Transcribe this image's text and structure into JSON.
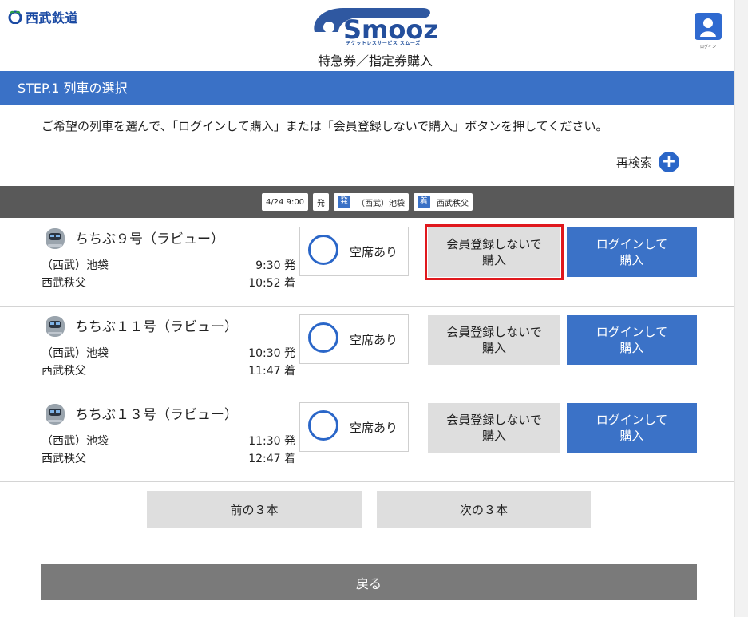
{
  "header": {
    "brand_name": "西武鉄道",
    "logo_text": "Smooz",
    "logo_subtitle": "チケットレスサービス スムーズ",
    "page_title": "特急券／指定券購入",
    "login_caption": "ログイン"
  },
  "step": {
    "title": "STEP.1 列車の選択"
  },
  "instruction": "ご希望の列車を選んで、「ログインして購入」または「会員登録しないで購入」ボタンを押してください。",
  "research_label": "再検索",
  "search_conditions": {
    "datetime": "4/24 9:00",
    "dep_tag": "発",
    "dep_tag2": "発",
    "dep_station": "（西武）池袋",
    "arr_tag": "着",
    "arr_station": "西武秩父"
  },
  "trains": [
    {
      "name": "ちちぶ９号（ラビュー）",
      "dep_station": "（西武）池袋",
      "dep_time": "9:30 発",
      "arr_station": "西武秩父",
      "arr_time": "10:52 着",
      "availability": "空席あり",
      "guest_button": "会員登録しないで 購入",
      "login_button": "ログインして 購入"
    },
    {
      "name": "ちちぶ１１号（ラビュー）",
      "dep_station": "（西武）池袋",
      "dep_time": "10:30 発",
      "arr_station": "西武秩父",
      "arr_time": "11:47 着",
      "availability": "空席あり",
      "guest_button": "会員登録しないで 購入",
      "login_button": "ログインして 購入"
    },
    {
      "name": "ちちぶ１３号（ラビュー）",
      "dep_station": "（西武）池袋",
      "dep_time": "11:30 発",
      "arr_station": "西武秩父",
      "arr_time": "12:47 着",
      "availability": "空席あり",
      "guest_button": "会員登録しないで 購入",
      "login_button": "ログインして 購入"
    }
  ],
  "pagination": {
    "prev": "前の３本",
    "next": "次の３本"
  },
  "back_button": "戻る",
  "colors": {
    "primary_blue": "#3a71c6",
    "highlight_red": "#e0181d",
    "brand_blue": "#1b4aa3"
  },
  "icons": {
    "brand": "seibu-logo-icon",
    "login": "user-icon",
    "research": "plus-circle-icon",
    "train": "train-icon",
    "availability": "circle-available-icon"
  }
}
